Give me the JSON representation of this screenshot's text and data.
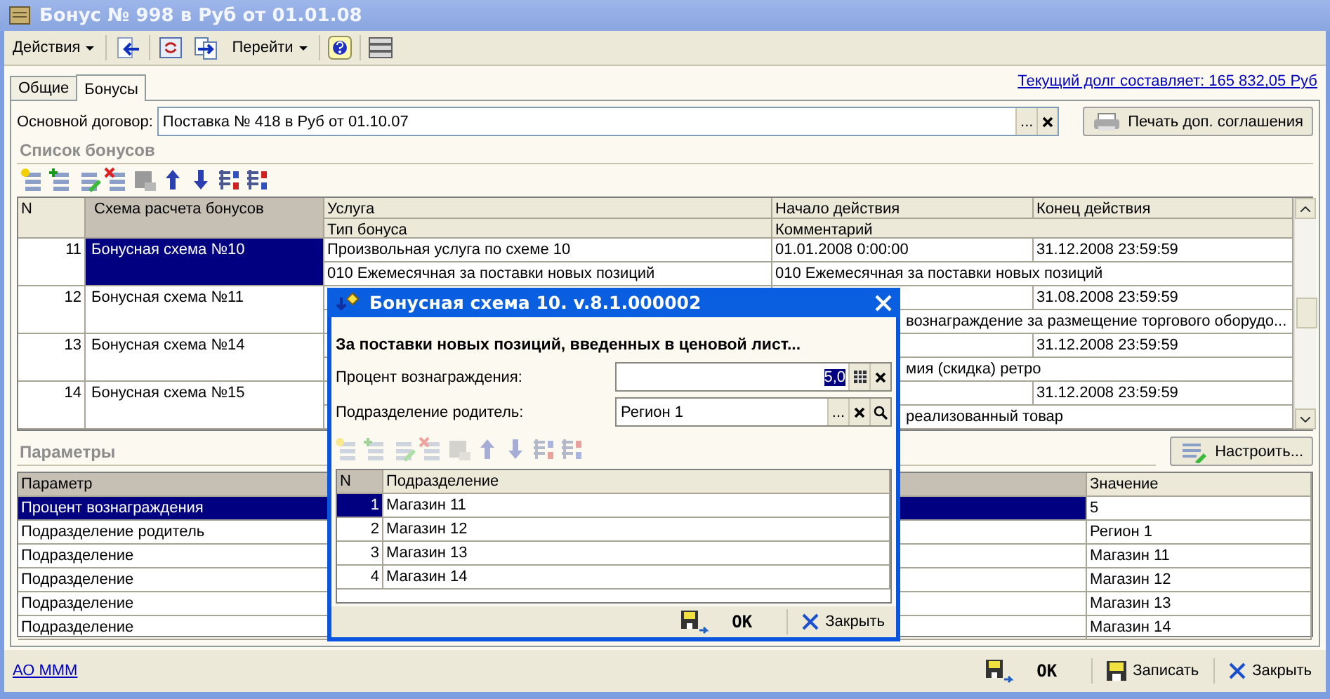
{
  "window": {
    "title": "Бонус № 998 в Руб от 01.01.08"
  },
  "toolbar": {
    "actions_menu": "Действия",
    "goto_menu": "Перейти"
  },
  "tabs": [
    {
      "label": "Общие",
      "selected": false
    },
    {
      "label": "Бонусы",
      "selected": true
    }
  ],
  "debt_link": "Текущий долг составляет: 165 832,05 Руб",
  "contract": {
    "label": "Основной договор:",
    "value": "Поставка № 418 в Руб от 01.10.07",
    "choose_button": "..."
  },
  "print_button": "Печать доп. соглашения",
  "bonuses": {
    "title": "Список бонусов",
    "columns": {
      "n": "N",
      "scheme": "Схема расчета бонусов",
      "service": "Услуга",
      "bonus_type": "Тип бонуса",
      "start": "Начало действия",
      "comment": "Комментарий",
      "end": "Конец действия"
    },
    "rows": [
      {
        "n": "11",
        "scheme": "Бонусная схема №10",
        "service": "Произвольная услуга по схеме 10",
        "bonus_type": "010 Ежемесячная за поставки новых позиций",
        "start": "01.01.2008 0:00:00",
        "end": "31.12.2008 23:59:59",
        "comment": "010 Ежемесячная за поставки новых позиций",
        "selected": true
      },
      {
        "n": "12",
        "scheme": "Бонусная схема №11",
        "end": "31.08.2008 23:59:59",
        "comment": "вознаграждение за размещение торгового оборудо...",
        "selected": false
      },
      {
        "n": "13",
        "scheme": "Бонусная схема №14",
        "end": "31.12.2008 23:59:59",
        "comment": "мия (скидка) ретро",
        "selected": false
      },
      {
        "n": "14",
        "scheme": "Бонусная схема №15",
        "end": "31.12.2008 23:59:59",
        "comment": "реализованный товар",
        "selected": false
      }
    ]
  },
  "parameters": {
    "title": "Параметры",
    "configure_button": "Настроить...",
    "columns": [
      "Параметр",
      "Значение"
    ],
    "rows": [
      {
        "name": "Процент вознаграждения",
        "value": "5",
        "selected": true
      },
      {
        "name": "Подразделение родитель",
        "value": "Регион 1",
        "selected": false
      },
      {
        "name": "Подразделение",
        "value": "Магазин 11",
        "selected": false
      },
      {
        "name": "Подразделение",
        "value": "Магазин 12",
        "selected": false
      },
      {
        "name": "Подразделение",
        "value": "Магазин 13",
        "selected": false
      },
      {
        "name": "Подразделение",
        "value": "Магазин 14",
        "selected": false
      }
    ]
  },
  "footer": {
    "org_link": "АО МММ",
    "ok_button": "OK",
    "save_button": "Записать",
    "close_button": "Закрыть"
  },
  "dialog": {
    "title": "Бонусная схема 10. v.8.1.000002",
    "heading": "За поставки новых позиций, введенных в ценовой лист...",
    "fields": [
      {
        "kind": "number",
        "label": "Процент вознаграждения:",
        "value": "5,0"
      },
      {
        "kind": "reference",
        "label": "Подразделение родитель:",
        "value": "Регион 1",
        "choose_button": "..."
      }
    ],
    "toolbar_disabled": true,
    "columns": [
      "N",
      "Подразделение"
    ],
    "rows": [
      {
        "n": "1",
        "name": "Магазин 11",
        "selected": true
      },
      {
        "n": "2",
        "name": "Магазин 12",
        "selected": false
      },
      {
        "n": "3",
        "name": "Магазин 13",
        "selected": false
      },
      {
        "n": "4",
        "name": "Магазин 14",
        "selected": false
      }
    ],
    "ok_button": "OK",
    "close_button": "Закрыть"
  }
}
